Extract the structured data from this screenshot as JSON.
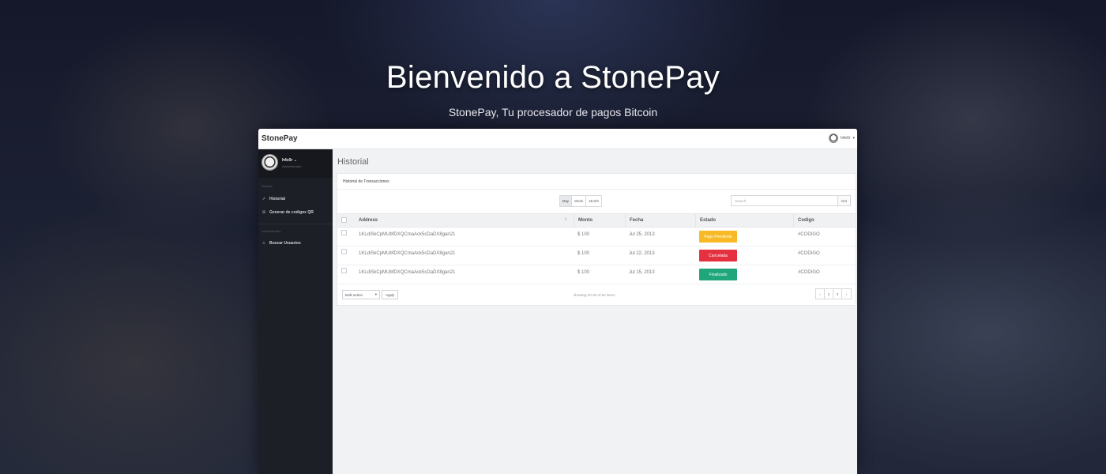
{
  "hero": {
    "title": "Bienvenido a StonePay",
    "subtitle": "StonePay, Tu procesador de pagos Bitcoin"
  },
  "app": {
    "brand": "StonePay",
    "user_menu": {
      "name": "h4x0r",
      "caret": "▾",
      "avatar_icon": "troll-face-avatar"
    }
  },
  "sidebar": {
    "profile": {
      "name": "h4x0r ⌄",
      "role": "Administrador"
    },
    "sections": [
      {
        "label": "Usuario"
      },
      {
        "label": "Administrador"
      }
    ],
    "items": [
      {
        "label": "Historial",
        "icon": "chart-icon",
        "glyph": "⇗"
      },
      {
        "label": "Generar de codigos QR",
        "icon": "qr-icon",
        "glyph": "⊞"
      },
      {
        "label": "Buscar Usuarios",
        "icon": "user-icon",
        "glyph": "♙"
      }
    ]
  },
  "main": {
    "page_title": "Historial",
    "panel_title": "Historial de Transacciones",
    "ranges": [
      "Day",
      "Week",
      "Month"
    ],
    "active_range": "Day",
    "search": {
      "placeholder": "Search",
      "button": "Go!"
    },
    "table": {
      "columns": [
        "Address",
        "Monto",
        "Fecha",
        "Estado",
        "Codigo"
      ],
      "rows": [
        {
          "address": "1KLdiSkCpMUbfDXQCmaAck5cDaDX8gan21",
          "amount": "$ 100",
          "date": "Jul 25, 2013",
          "status": "Pago Pendiente",
          "status_color": "#f7b924",
          "code": "#CODIGO"
        },
        {
          "address": "1KLdiSkCpMUbfDXQCmaAck5cDaDX8gan21",
          "amount": "$ 100",
          "date": "Jul 22, 2013",
          "status": "Cancelada",
          "status_color": "#e4303f",
          "code": "#CODIGO"
        },
        {
          "address": "1KLdiSkCpMUbfDXQCmaAck5cDaDX8gan21",
          "amount": "$ 100",
          "date": "Jul 15, 2013",
          "status": "Finalizado",
          "status_color": "#1fa67a",
          "code": "#CODIGO"
        }
      ]
    },
    "bulk": {
      "select_label": "Bulk action",
      "apply": "Apply"
    },
    "showing": "showing 20-30 of 50 items",
    "pager": [
      "‹",
      "1",
      "2",
      "›"
    ]
  }
}
